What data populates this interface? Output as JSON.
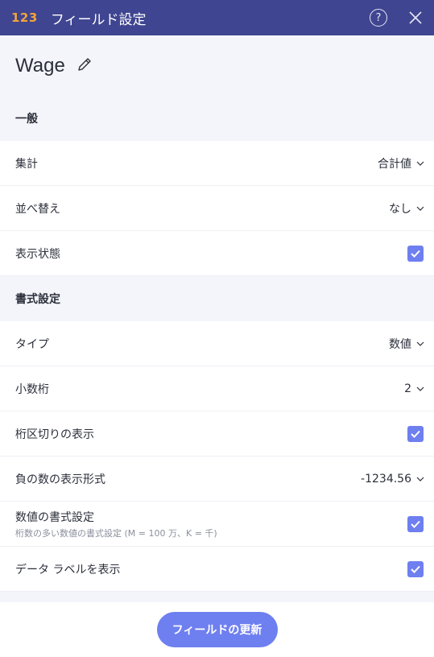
{
  "header": {
    "type_icon": "123",
    "title": "フィールド設定",
    "help_icon": "help-circle-icon",
    "close_icon": "close-icon"
  },
  "field": {
    "name": "Wage",
    "edit_icon": "pencil-icon"
  },
  "sections": {
    "general": "一般",
    "format": "書式設定"
  },
  "general": {
    "aggregation": {
      "label": "集計",
      "value": "合計値"
    },
    "sort": {
      "label": "並べ替え",
      "value": "なし"
    },
    "visibility": {
      "label": "表示状態",
      "checked": true
    }
  },
  "format": {
    "type": {
      "label": "タイプ",
      "value": "数値"
    },
    "decimals": {
      "label": "小数桁",
      "value": "2"
    },
    "thousands_separator": {
      "label": "桁区切りの表示",
      "checked": true
    },
    "negative_format": {
      "label": "負の数の表示形式",
      "value": "-1234.56"
    },
    "number_format": {
      "label": "数値の書式設定",
      "sublabel": "桁数の多い数値の書式設定 (M = 100 万、K = 千)",
      "checked": true
    },
    "data_labels": {
      "label": "データ ラベルを表示",
      "checked": true
    }
  },
  "footer": {
    "update_button": "フィールドの更新"
  },
  "colors": {
    "header_bg": "#3f4590",
    "accent": "#6e7ff0",
    "type_icon": "#f2a33a"
  }
}
